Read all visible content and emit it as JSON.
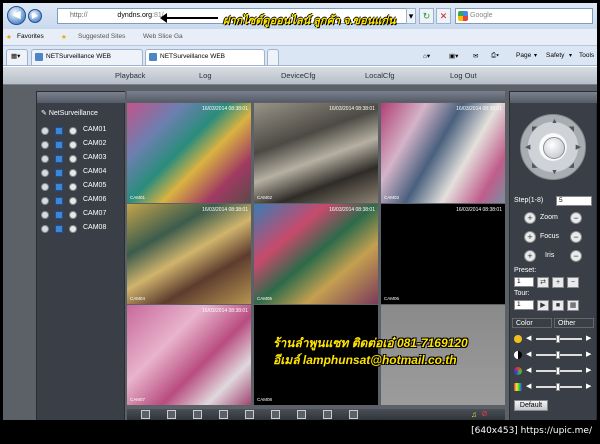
{
  "browser": {
    "url_prefix": "http://",
    "url_host": "dyndns.org",
    "url_port": ":81/",
    "search_placeholder": "Google",
    "annotation": "ฝากไซต์ดูออนไลน์ ลูกค้า จ.ขอนแก่น",
    "favorites_label": "Favorites",
    "suggested_sites": "Suggested Sites",
    "web_slice": "Web Slice Ga",
    "tabs": [
      "NETSurveillance WEB",
      "NETSurveillance WEB"
    ],
    "cmd": {
      "page": "Page",
      "safety": "Safety",
      "tools": "Tools"
    }
  },
  "app": {
    "menu": [
      "Playback",
      "Log",
      "DeviceCfg",
      "LocalCfg",
      "Log Out"
    ],
    "tree_root": "NetSurveillance",
    "cameras": [
      "CAM01",
      "CAM02",
      "CAM03",
      "CAM04",
      "CAM05",
      "CAM06",
      "CAM07",
      "CAM08"
    ],
    "video_cells": [
      {
        "ts": "16/03/2014 08:38:01",
        "cn": "CAM01"
      },
      {
        "ts": "16/03/2014 08:38:01",
        "cn": "CAM02"
      },
      {
        "ts": "16/03/2014 08:38:01",
        "cn": "CAM03"
      },
      {
        "ts": "16/03/2014 08:38:01",
        "cn": "CAM04"
      },
      {
        "ts": "16/03/2014 08:38:01",
        "cn": "CAM05"
      },
      {
        "ts": "16/03/2014 08:38:01",
        "cn": "CAM06"
      },
      {
        "ts": "16/03/2014 08:38:01",
        "cn": "CAM07"
      },
      {
        "ts": "",
        "cn": "CAM08"
      },
      {
        "ts": "",
        "cn": ""
      }
    ],
    "overlay_line1": "ร้านลำพูนแซท ติดต่อเอ๋ 081-7169120",
    "overlay_line2": "อีเมล์ lamphunsat@hotmail.co.th",
    "ptz": {
      "step_label": "Step(1-8)",
      "step_value": "5",
      "zoom": "Zoom",
      "focus": "Focus",
      "iris": "Iris",
      "preset_label": "Preset:",
      "preset_value": "1",
      "tour_label": "Tour:",
      "tour_value": "1"
    },
    "color_tab": "Color",
    "other_tab": "Other",
    "default_btn": "Default"
  },
  "watermark": "[640x453] https://upic.me/"
}
